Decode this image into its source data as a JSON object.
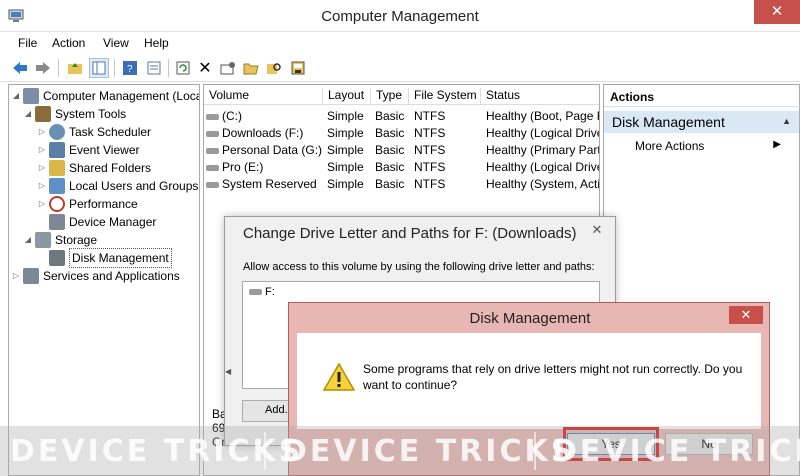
{
  "window": {
    "title": "Computer Management",
    "close_glyph": "✕"
  },
  "menu": [
    "File",
    "Action",
    "View",
    "Help"
  ],
  "toolbar": {
    "icons": [
      "back-icon",
      "forward-icon",
      "up-folder-icon",
      "show-hide-tree-icon",
      "help-icon",
      "properties-icon",
      "refresh-icon",
      "delete-icon",
      "settings-icon",
      "open-folder-icon",
      "search-icon",
      "disk-properties-icon"
    ]
  },
  "tree": {
    "items": [
      {
        "label": "Computer Management (Local",
        "icon_color": "#7a8ea6"
      },
      {
        "label": "System Tools",
        "icon_color": "#8a6b3b"
      },
      {
        "label": "Task Scheduler",
        "icon_color": "#6a8fb5"
      },
      {
        "label": "Event Viewer",
        "icon_color": "#5c7fa8"
      },
      {
        "label": "Shared Folders",
        "icon_color": "#d9b64a"
      },
      {
        "label": "Local Users and Groups",
        "icon_color": "#5f8fc7"
      },
      {
        "label": "Performance",
        "icon_color": "#c0392b"
      },
      {
        "label": "Device Manager",
        "icon_color": "#7d8894"
      },
      {
        "label": "Storage",
        "icon_color": "#8c96a3"
      },
      {
        "label": "Disk Management",
        "icon_color": "#6f7780"
      },
      {
        "label": "Services and Applications",
        "icon_color": "#7d8894"
      }
    ]
  },
  "volumes": {
    "headers": [
      "Volume",
      "Layout",
      "Type",
      "File System",
      "Status"
    ],
    "rows": [
      {
        "volume": "(C:)",
        "layout": "Simple",
        "type": "Basic",
        "fs": "NTFS",
        "status": "Healthy (Boot, Page F"
      },
      {
        "volume": "Downloads (F:)",
        "layout": "Simple",
        "type": "Basic",
        "fs": "NTFS",
        "status": "Healthy (Logical Drive"
      },
      {
        "volume": "Personal Data (G:)",
        "layout": "Simple",
        "type": "Basic",
        "fs": "NTFS",
        "status": "Healthy (Primary Part"
      },
      {
        "volume": "Pro (E:)",
        "layout": "Simple",
        "type": "Basic",
        "fs": "NTFS",
        "status": "Healthy (Logical Drive"
      },
      {
        "volume": "System Reserved",
        "layout": "Simple",
        "type": "Basic",
        "fs": "NTFS",
        "status": "Healthy (System, Acti"
      }
    ],
    "bottom_fragments": [
      "Ba",
      "69",
      "Or"
    ]
  },
  "actions": {
    "header": "Actions",
    "selected": "Disk Management",
    "more": "More Actions"
  },
  "change_dialog": {
    "title": "Change Drive Letter and Paths for F: (Downloads)",
    "instruction": "Allow access to this volume by using the following drive letter and paths:",
    "entry": "F:",
    "add_label": "Add..."
  },
  "confirm_dialog": {
    "title": "Disk Management",
    "message": "Some programs that rely on drive letters might not run correctly. Do you want to continue?",
    "yes_label": "Yes",
    "no_label": "No",
    "close_glyph": "✕"
  },
  "watermark": {
    "segments": [
      "DEVICE TRICKS",
      "DEVICE TRICKS",
      "DEVICE TRICKS"
    ]
  }
}
